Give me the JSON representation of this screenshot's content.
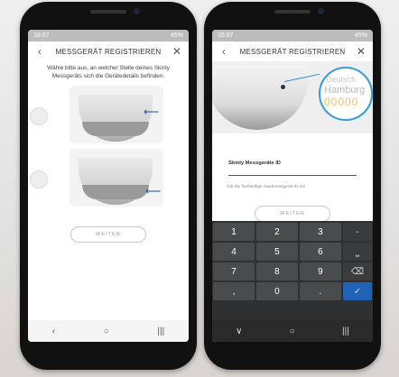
{
  "left": {
    "status": {
      "time": "16:07",
      "battery": "45%"
    },
    "header": {
      "back": "‹",
      "title": "MESSGERÄT REGISTRIEREN",
      "close": "✕"
    },
    "instructions": "Wähle bitte aus, an welcher Stelle deines Skinly Messgeräts sich die Gerätedetails befinden.",
    "continue": "WEITER",
    "nav": {
      "back": "‹",
      "home": "○",
      "recent": "|||"
    }
  },
  "right": {
    "status": {
      "time": "16:07",
      "battery": "45%"
    },
    "header": {
      "back": "‹",
      "title": "MESSGERÄT REGISTRIEREN",
      "close": "✕"
    },
    "magnifier": {
      "line1": "Deutsch",
      "line2": "Hamburg",
      "line3": "00000"
    },
    "field_label": "Skinly Messgeräte ID",
    "field_hint": "Gib die fünfstellige Hautmessgerät ID ein",
    "continue": "WEITER",
    "keyboard": {
      "row1": [
        "1",
        "2",
        "3",
        "-"
      ],
      "row2": [
        "4",
        "5",
        "6",
        "⎵"
      ],
      "row3": [
        "7",
        "8",
        "9",
        "⌫"
      ],
      "row4": [
        ",",
        "0",
        ".",
        "✓"
      ]
    },
    "nav": {
      "back": "∨",
      "home": "○",
      "recent": "|||"
    }
  },
  "colors": {
    "accent": "#1e63b8",
    "lens": "#3a9ad9"
  }
}
